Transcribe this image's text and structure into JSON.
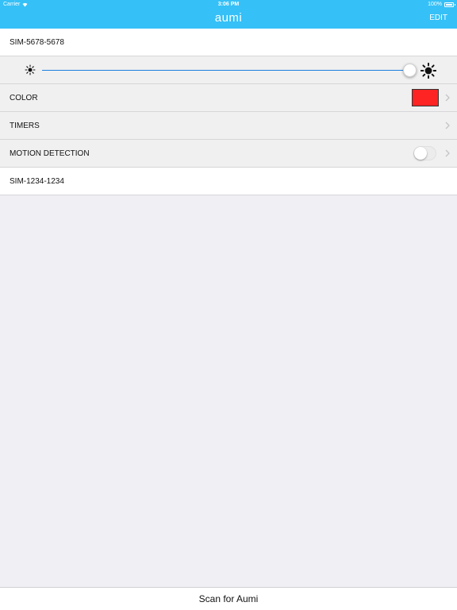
{
  "status_bar": {
    "carrier": "Carrier",
    "time": "3:06 PM",
    "battery": "100%"
  },
  "nav": {
    "title": "aumi",
    "edit_label": "EDIT"
  },
  "devices": [
    {
      "name": "SIM-5678-5678",
      "brightness": 1.0,
      "settings": {
        "color_label": "COLOR",
        "color_value": "#ff2424",
        "timers_label": "TIMERS",
        "motion_label": "MOTION DETECTION",
        "motion_enabled": false
      }
    },
    {
      "name": "SIM-1234-1234"
    }
  ],
  "bottom": {
    "scan_label": "Scan for Aumi"
  },
  "colors": {
    "accent": "#35c0f7",
    "slider_track": "#1a7fe0",
    "background": "#efeff4"
  },
  "icons": {
    "brightness_low": "sun-small-icon",
    "brightness_high": "sun-large-icon",
    "disclosure": "chevron-right-icon"
  }
}
